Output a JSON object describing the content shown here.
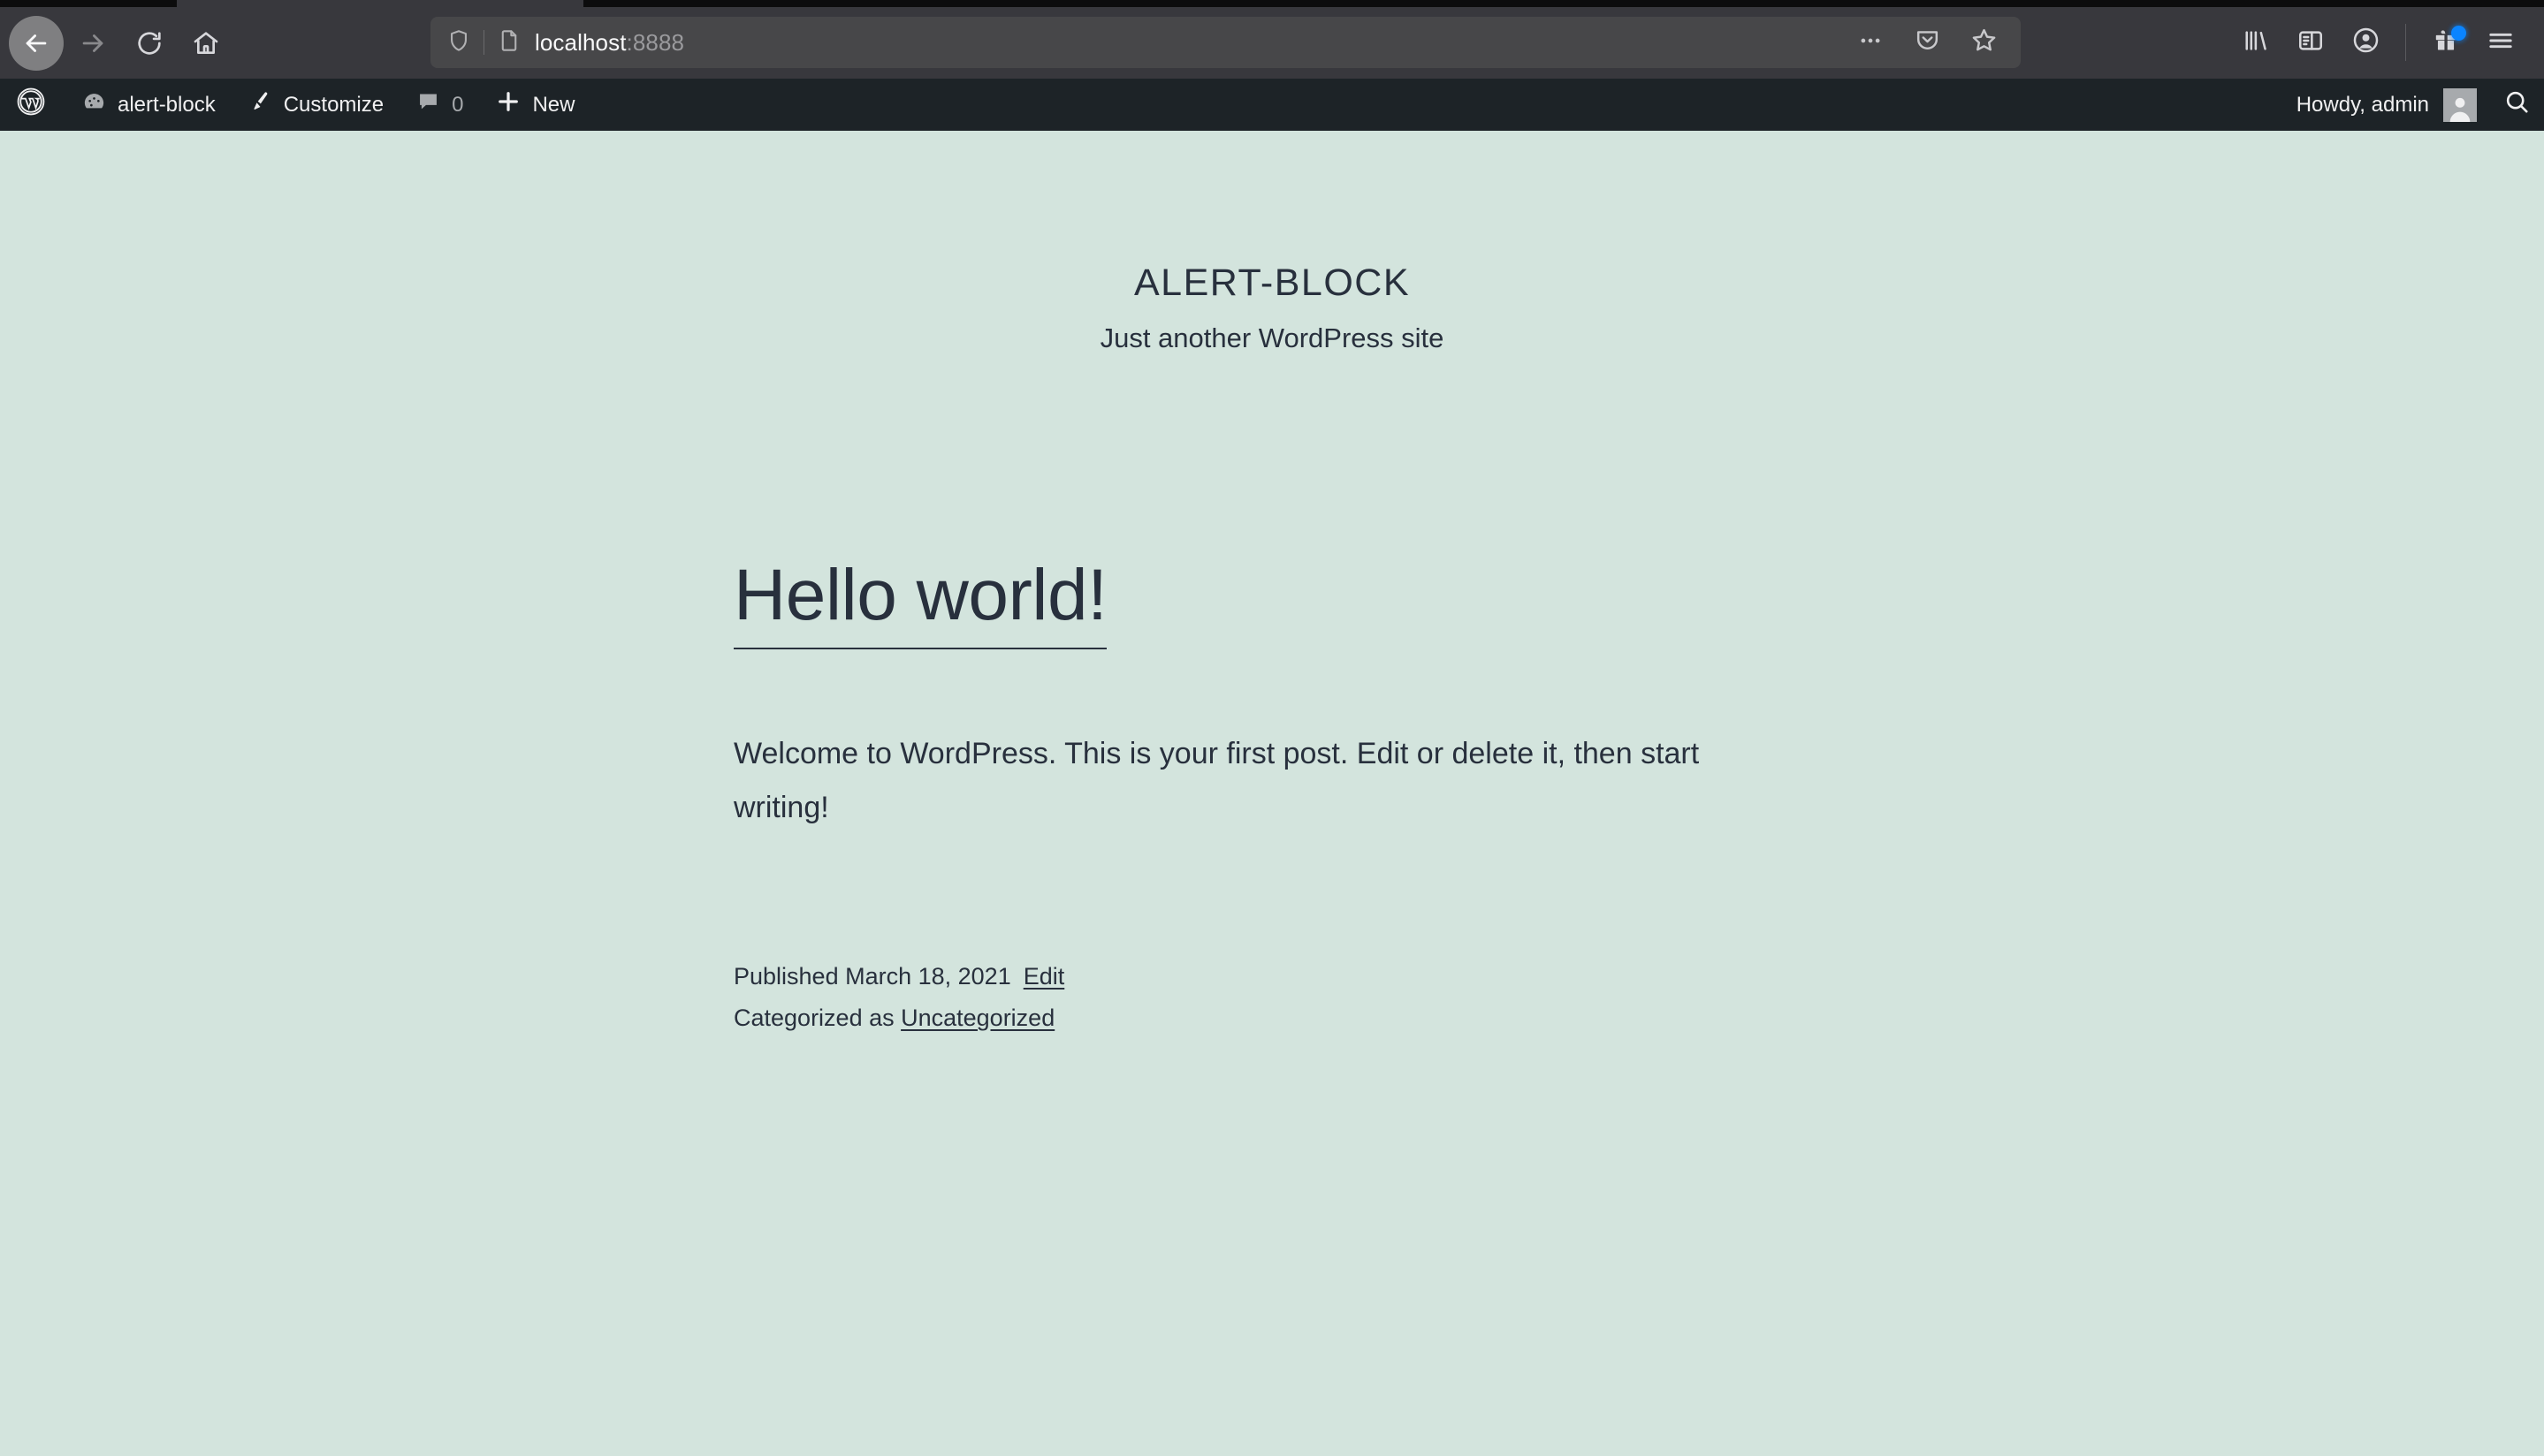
{
  "browser": {
    "nav": {
      "back_label": "Back",
      "forward_label": "Forward",
      "reload_label": "Reload",
      "home_label": "Home"
    },
    "urlbar": {
      "host": "localhost",
      "port": ":8888",
      "full_url": "localhost:8888",
      "shield_label": "Tracking Protection",
      "page_info_label": "Page Info",
      "more_label": "More actions",
      "pocket_label": "Save to Pocket",
      "bookmark_label": "Bookmark this page"
    },
    "toolbar": {
      "library_label": "Library",
      "sidebar_label": "Sidebar",
      "account_label": "Account",
      "gift_label": "Gift",
      "menu_label": "Open application menu",
      "gift_badge": true
    },
    "colors": {
      "chrome_bg": "#38383d",
      "urlbar_bg": "#474749",
      "badge_blue": "#0a84ff"
    }
  },
  "adminbar": {
    "wp_logo_label": "About WordPress",
    "site_name": "alert-block",
    "customize_label": "Customize",
    "comments_count": "0",
    "new_label": "New",
    "howdy_label": "Howdy, admin",
    "search_label": "Search",
    "colors": {
      "bg": "#1d2327",
      "text": "#f0f0f1",
      "muted": "#a7aaad"
    }
  },
  "site": {
    "title": "ALERT-BLOCK",
    "tagline": "Just another WordPress site",
    "colors": {
      "background": "#d3e4dd",
      "foreground": "#28303d"
    }
  },
  "post": {
    "title": "Hello world!",
    "body": "Welcome to WordPress. This is your first post. Edit or delete it, then start writing!",
    "published_text": "Published March 18, 2021",
    "edit_link": "Edit",
    "categorized_prefix": "Categorized as ",
    "category": "Uncategorized"
  }
}
